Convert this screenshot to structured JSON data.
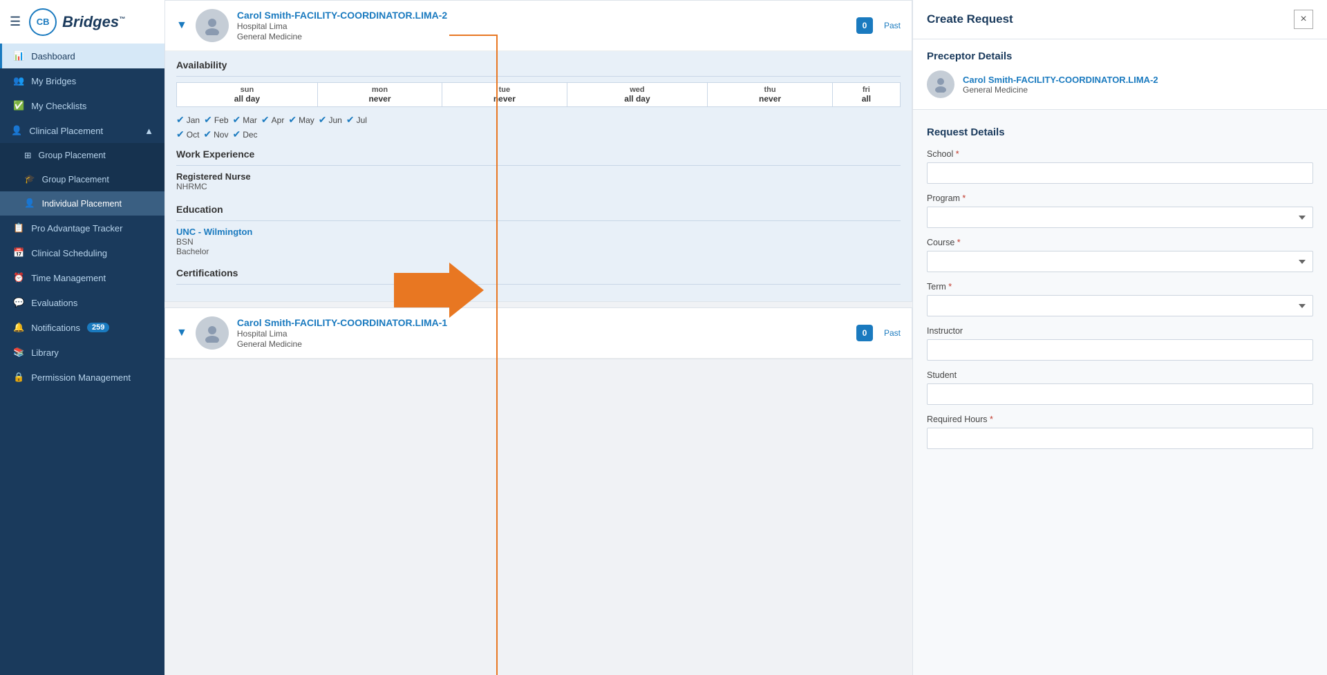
{
  "app": {
    "name": "Bridges",
    "tm": "™"
  },
  "sidebar": {
    "hamburger": "☰",
    "logo_letters": "CB",
    "items": [
      {
        "id": "dashboard",
        "label": "Dashboard",
        "icon": "dashboard",
        "active": true
      },
      {
        "id": "my-bridges",
        "label": "My Bridges",
        "icon": "bridges"
      },
      {
        "id": "my-checklists",
        "label": "My Checklists",
        "icon": "checklists"
      },
      {
        "id": "clinical-placement",
        "label": "Clinical Placement",
        "icon": "clinical",
        "expandable": true,
        "expanded": true
      },
      {
        "id": "group-placement-1",
        "label": "Group Placement",
        "icon": "group",
        "sub": true
      },
      {
        "id": "group-placement-2",
        "label": "Group Placement",
        "icon": "cap",
        "sub": true
      },
      {
        "id": "individual-placement",
        "label": "Individual Placement",
        "icon": "person",
        "sub": true,
        "active_sub": true
      },
      {
        "id": "pro-advantage",
        "label": "Pro Advantage Tracker",
        "icon": "clipboard"
      },
      {
        "id": "clinical-scheduling",
        "label": "Clinical Scheduling",
        "icon": "calendar"
      },
      {
        "id": "time-management",
        "label": "Time Management",
        "icon": "time"
      },
      {
        "id": "evaluations",
        "label": "Evaluations",
        "icon": "eval"
      },
      {
        "id": "notifications",
        "label": "Notifications",
        "icon": "bell",
        "badge": "259"
      },
      {
        "id": "library",
        "label": "Library",
        "icon": "book"
      },
      {
        "id": "permission-management",
        "label": "Permission Management",
        "icon": "lock"
      }
    ]
  },
  "profile_card_1": {
    "name": "Carol Smith-FACILITY-COORDINATOR.LIMA-2",
    "hospital": "Hospital Lima",
    "specialty": "General Medicine",
    "badge_count": "0",
    "past_label": "Past"
  },
  "availability": {
    "title": "Availability",
    "days": [
      {
        "day": "sun",
        "time": "all day"
      },
      {
        "day": "mon",
        "time": "never"
      },
      {
        "day": "tue",
        "time": "never"
      },
      {
        "day": "wed",
        "time": "all day"
      },
      {
        "day": "thu",
        "time": "never"
      },
      {
        "day": "fri",
        "time": "all"
      }
    ],
    "months": [
      "Jan",
      "Feb",
      "Mar",
      "Apr",
      "May",
      "Jun",
      "Jul",
      "Oct",
      "Nov",
      "Dec"
    ]
  },
  "work_experience": {
    "title": "Work Experience",
    "items": [
      {
        "title": "Registered Nurse",
        "company": "NHRMC"
      }
    ]
  },
  "education": {
    "title": "Education",
    "items": [
      {
        "school": "UNC - Wilmington",
        "degree": "BSN",
        "level": "Bachelor"
      }
    ]
  },
  "certifications": {
    "title": "Certifications"
  },
  "profile_card_2": {
    "name": "Carol Smith-FACILITY-COORDINATOR.LIMA-1",
    "hospital": "Hospital Lima",
    "specialty": "General Medicine",
    "badge_count": "0",
    "past_label": "Past"
  },
  "create_request_panel": {
    "title": "Create Request",
    "close_label": "×",
    "preceptor_section_title": "Preceptor Details",
    "preceptor_name": "Carol Smith-FACILITY-COORDINATOR.LIMA-2",
    "preceptor_specialty": "General Medicine",
    "request_section_title": "Request Details",
    "form_fields": [
      {
        "id": "school",
        "label": "School",
        "required": true,
        "type": "text",
        "placeholder": ""
      },
      {
        "id": "program",
        "label": "Program",
        "required": true,
        "type": "select",
        "placeholder": ""
      },
      {
        "id": "course",
        "label": "Course",
        "required": true,
        "type": "select",
        "placeholder": ""
      },
      {
        "id": "term",
        "label": "Term",
        "required": true,
        "type": "select",
        "placeholder": ""
      },
      {
        "id": "instructor",
        "label": "Instructor",
        "required": false,
        "type": "text",
        "placeholder": ""
      },
      {
        "id": "student",
        "label": "Student",
        "required": false,
        "type": "text",
        "placeholder": ""
      },
      {
        "id": "required-hours",
        "label": "Required Hours",
        "required": true,
        "type": "text",
        "placeholder": ""
      }
    ]
  }
}
